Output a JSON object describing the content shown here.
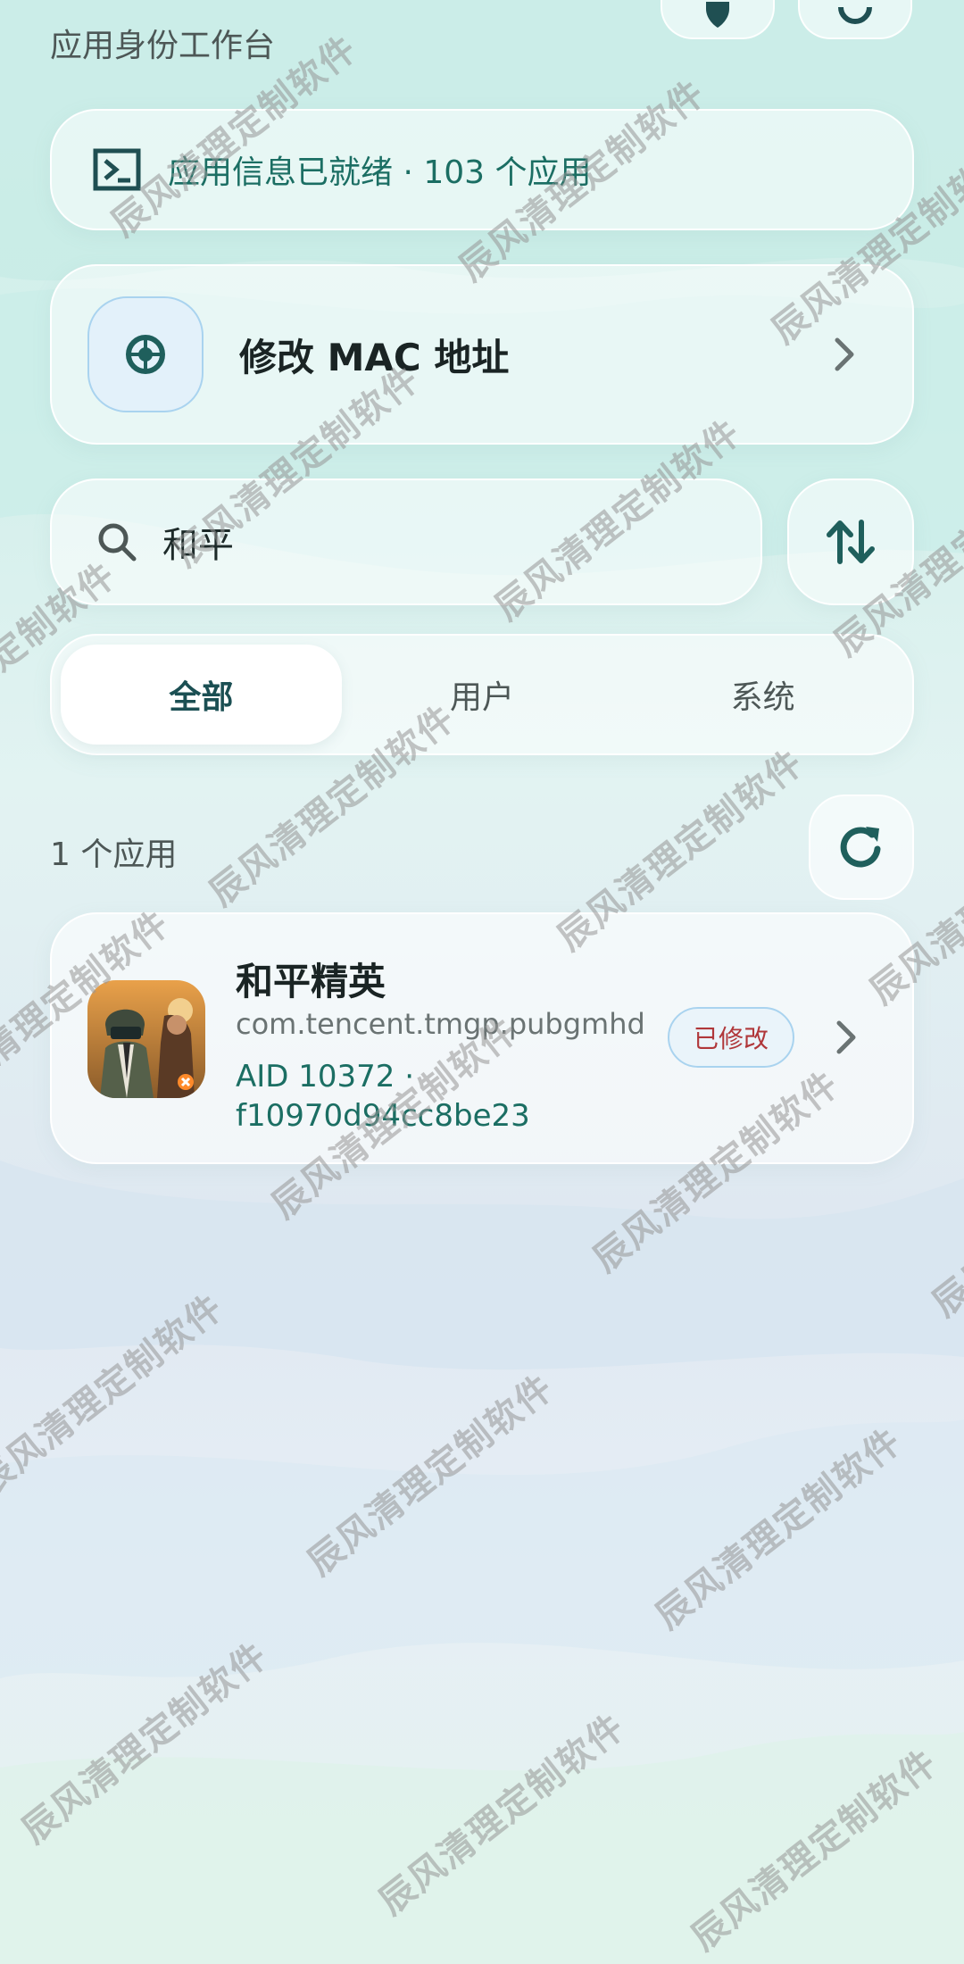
{
  "header": {
    "title": "应用身份工作台",
    "actions": [
      {
        "icon": "shield-icon"
      },
      {
        "icon": "circle-icon"
      }
    ]
  },
  "status": {
    "icon": "terminal-icon",
    "text": "应用信息已就绪 · 103 个应用"
  },
  "mac_card": {
    "icon": "compass-icon",
    "label": "修改 MAC 地址"
  },
  "search": {
    "value": "和平",
    "icon": "search-icon"
  },
  "sort": {
    "icon": "sort-arrows-icon"
  },
  "tabs": [
    {
      "label": "全部",
      "active": true
    },
    {
      "label": "用户",
      "active": false
    },
    {
      "label": "系统",
      "active": false
    }
  ],
  "list": {
    "count_label": "1 个应用",
    "apps": [
      {
        "name": "和平精英",
        "package": "com.tencent.tmgp.pubgmhd",
        "aid_line1": "AID 10372 ·",
        "aid_line2": "f10970d94cc8be23",
        "badge": "已修改"
      }
    ]
  },
  "watermark": {
    "text": "辰风清理定制软件"
  },
  "colors": {
    "accent": "#1b6e63",
    "badge_text": "#b0373a",
    "badge_border": "#a9d3ef"
  }
}
